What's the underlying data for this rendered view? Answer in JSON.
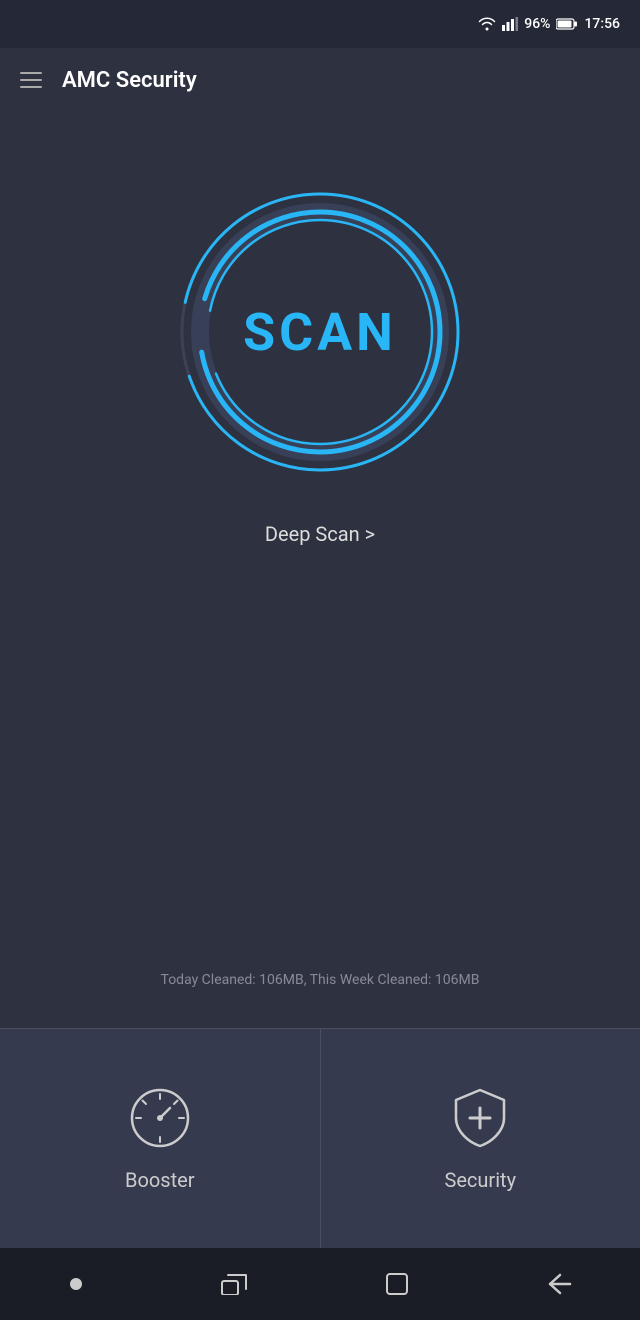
{
  "statusBar": {
    "battery": "96%",
    "time": "17:56"
  },
  "titleBar": {
    "appName": "AMC Security"
  },
  "scanButton": {
    "label": "SCAN"
  },
  "deepScan": {
    "label": "Deep Scan >"
  },
  "stats": {
    "text": "Today Cleaned: 106MB, This Week Cleaned: 106MB"
  },
  "features": [
    {
      "id": "booster",
      "label": "Booster",
      "icon": "speedometer-icon"
    },
    {
      "id": "security",
      "label": "Security",
      "icon": "shield-icon"
    }
  ],
  "navigation": [
    {
      "id": "home",
      "icon": "home-dot-icon"
    },
    {
      "id": "recent",
      "icon": "recent-apps-icon"
    },
    {
      "id": "square",
      "icon": "square-icon"
    },
    {
      "id": "back",
      "icon": "back-icon"
    }
  ]
}
